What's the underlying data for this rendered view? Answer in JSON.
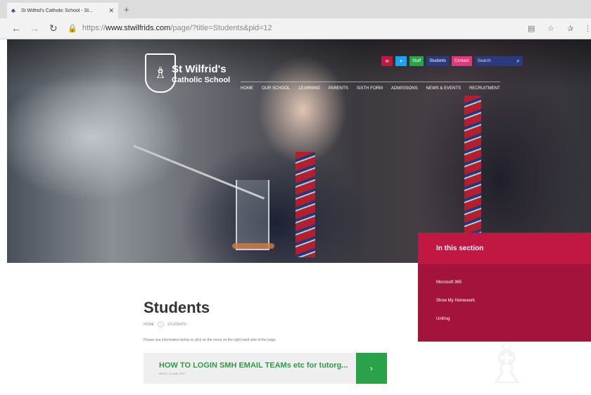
{
  "browser": {
    "tab_title": "St Wilfrid's Catholic School - St...",
    "url_prefix": "https://",
    "url_domain": "www.stwilfrids.com",
    "url_path": "/page/?title=Students&pid=12"
  },
  "site": {
    "name_line1": "St Wilfrid's",
    "name_line2": "Catholic School",
    "top_buttons": [
      "Staff",
      "Students",
      "Contact"
    ],
    "search_placeholder": "Search",
    "nav": [
      "HOME",
      "OUR SCHOOL",
      "LEARNING",
      "PARENTS",
      "SIXTH FORM",
      "ADMISSIONS",
      "NEWS & EVENTS",
      "RECRUITMENT"
    ]
  },
  "section": {
    "heading": "In this section",
    "links": [
      "Microsoft 365",
      "Show My Homework",
      "Unifrog"
    ]
  },
  "content": {
    "title": "Students",
    "breadcrumb": [
      "HOME",
      "STUDENTS"
    ],
    "intro": "Please see information below or click on the menu on the right hand side of the page.",
    "doc_title": "HOW TO LOGIN SMH EMAIL TEAMs etc for tutorg...",
    "doc_meta": "MS19 | 3.4 MB | PDF"
  },
  "colors": {
    "accent_red": "#c01743",
    "section_bg": "#a3133b",
    "green": "#2aa24a",
    "navy": "#2b3a7a",
    "pink": "#e0387d"
  }
}
